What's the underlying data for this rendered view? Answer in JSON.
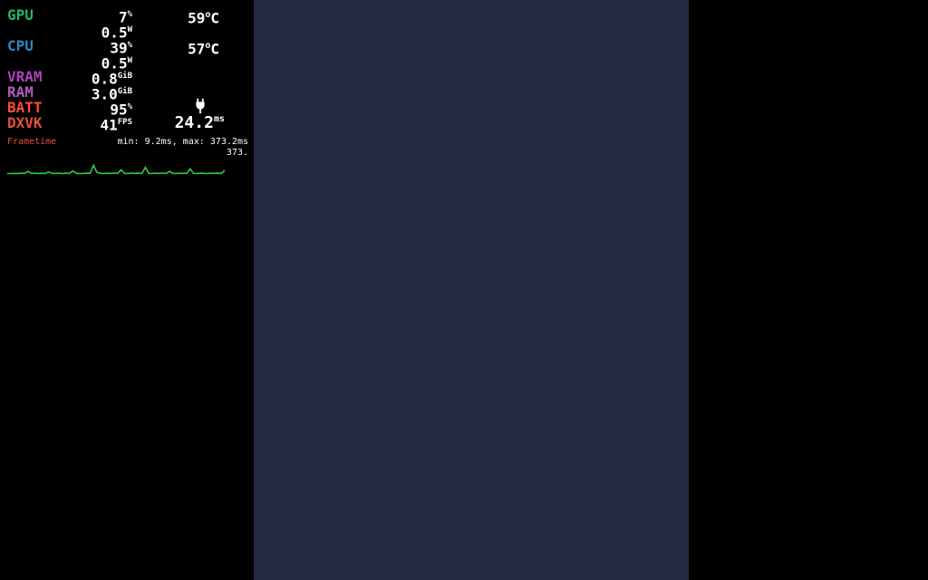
{
  "overlay": {
    "gpu": {
      "label": "GPU",
      "usage": "7",
      "usage_unit": "%",
      "power": "0.5",
      "power_unit": "W",
      "temp": "59",
      "temp_unit": "C"
    },
    "cpu": {
      "label": "CPU",
      "usage": "39",
      "usage_unit": "%",
      "power": "0.5",
      "power_unit": "W",
      "temp": "57",
      "temp_unit": "C"
    },
    "vram": {
      "label": "VRAM",
      "value": "0.8",
      "unit": "GiB"
    },
    "ram": {
      "label": "RAM",
      "value": "3.0",
      "unit": "GiB"
    },
    "batt": {
      "label": "BATT",
      "value": "95",
      "unit": "%"
    },
    "dxvk": {
      "label": "DXVK",
      "fps": "41",
      "fps_unit": "FPS",
      "ms": "24.2",
      "ms_unit": "ms"
    },
    "frametime": {
      "label": "Frametime",
      "range": "min: 9.2ms, max: 373.2ms",
      "max_label": "373."
    }
  },
  "colors": {
    "graph": "#2ecc40"
  },
  "chart_data": {
    "type": "line",
    "title": "Frametime",
    "ylabel": "ms",
    "ylim": [
      0,
      373.2
    ],
    "x": [],
    "values": [
      20,
      18,
      22,
      19,
      25,
      21,
      60,
      20,
      24,
      19,
      23,
      20,
      50,
      22,
      19,
      26,
      18,
      24,
      21,
      70,
      22,
      20,
      19,
      25,
      23,
      180,
      40,
      22,
      19,
      24,
      20,
      26,
      21,
      90,
      22,
      19,
      27,
      21,
      25,
      20,
      140,
      22,
      19,
      24,
      21,
      26,
      20,
      60,
      22,
      19,
      25,
      21,
      23,
      110,
      21,
      20,
      25,
      22,
      19,
      27,
      21,
      24,
      20,
      80
    ]
  }
}
